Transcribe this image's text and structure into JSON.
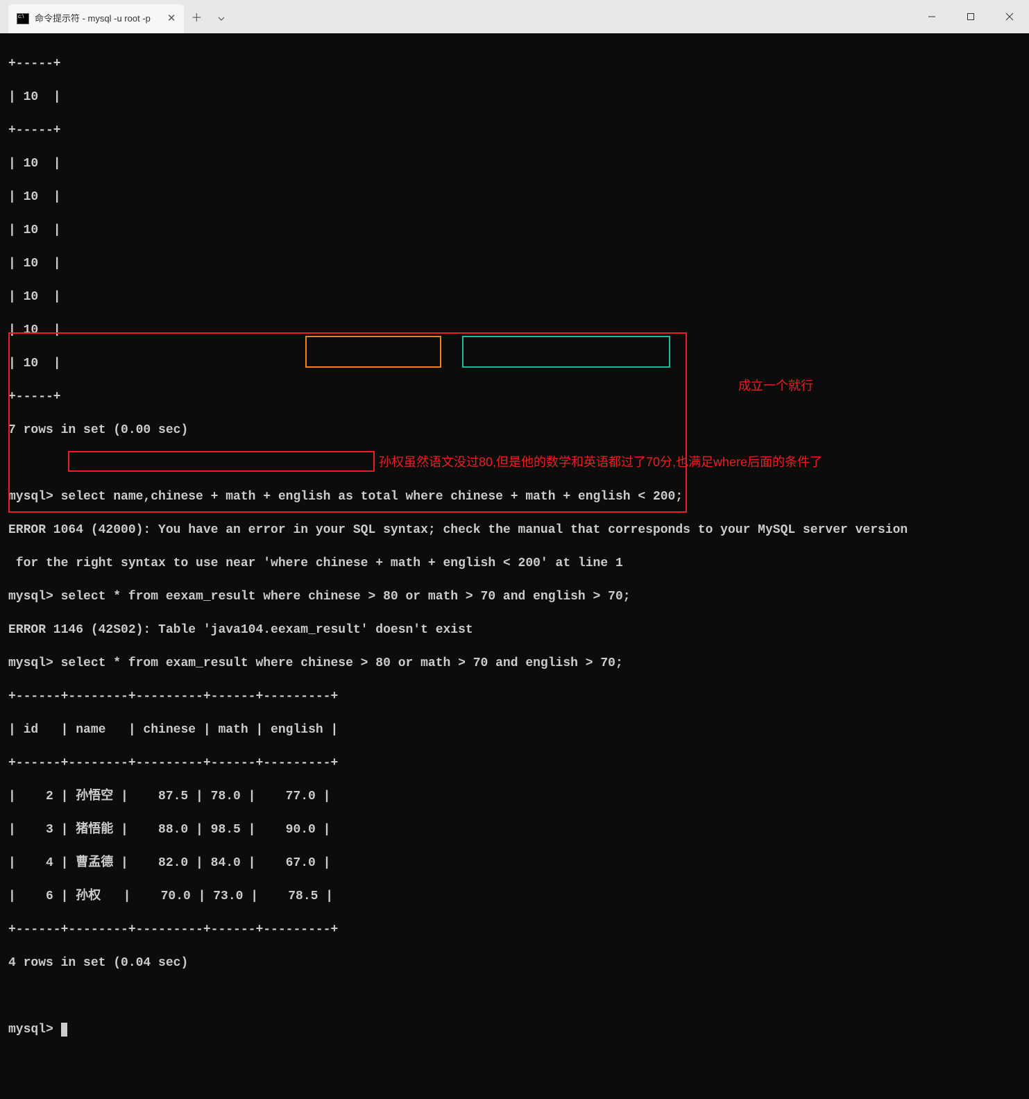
{
  "tab": {
    "title": "命令提示符 - mysql  -u root -p"
  },
  "terminal_lines": {
    "l0": "+-----+",
    "l1": "| 10  |",
    "l2": "+-----+",
    "l3": "| 10  |",
    "l4": "| 10  |",
    "l5": "| 10  |",
    "l6": "| 10  |",
    "l7": "| 10  |",
    "l8": "| 10  |",
    "l9": "| 10  |",
    "l10": "+-----+",
    "l11": "7 rows in set (0.00 sec)",
    "l12": "",
    "l13": "mysql> select name,chinese + math + english as total where chinese + math + english < 200;",
    "l14": "ERROR 1064 (42000): You have an error in your SQL syntax; check the manual that corresponds to your MySQL server version",
    "l15": " for the right syntax to use near 'where chinese + math + english < 200' at line 1",
    "l16": "mysql> select * from eexam_result where chinese > 80 or math > 70 and english > 70;",
    "l17": "ERROR 1146 (42S02): Table 'java104.eexam_result' doesn't exist",
    "l18": "mysql> select * from exam_result where chinese > 80 or math > 70 and english > 70;",
    "l19": "+------+--------+---------+------+---------+",
    "l20": "| id   | name   | chinese | math | english |",
    "l21": "+------+--------+---------+------+---------+",
    "l22": "|    2 | 孙悟空 |    87.5 | 78.0 |    77.0 |",
    "l23": "|    3 | 猪悟能 |    88.0 | 98.5 |    90.0 |",
    "l24": "|    4 | 曹孟德 |    82.0 | 84.0 |    67.0 |",
    "l25": "|    6 | 孙权   |    70.0 | 73.0 |    78.5 |",
    "l26": "+------+--------+---------+------+---------+",
    "l27": "4 rows in set (0.04 sec)",
    "l28": "",
    "l29_prompt": "mysql> "
  },
  "annotations": {
    "a1": "成立一个就行",
    "a2": "孙权虽然语文没过80,但是他的数学和英语都过了70分,也满足where后面的条件了"
  },
  "chart_data": {
    "type": "table",
    "title": "exam_result where chinese > 80 or math > 70 and english > 70",
    "columns": [
      "id",
      "name",
      "chinese",
      "math",
      "english"
    ],
    "rows": [
      {
        "id": 2,
        "name": "孙悟空",
        "chinese": 87.5,
        "math": 78.0,
        "english": 77.0
      },
      {
        "id": 3,
        "name": "猪悟能",
        "chinese": 88.0,
        "math": 98.5,
        "english": 90.0
      },
      {
        "id": 4,
        "name": "曹孟德",
        "chinese": 82.0,
        "math": 84.0,
        "english": 67.0
      },
      {
        "id": 6,
        "name": "孙权",
        "chinese": 70.0,
        "math": 73.0,
        "english": 78.5
      }
    ],
    "rows_in_set": 4,
    "elapsed_sec": 0.04
  }
}
